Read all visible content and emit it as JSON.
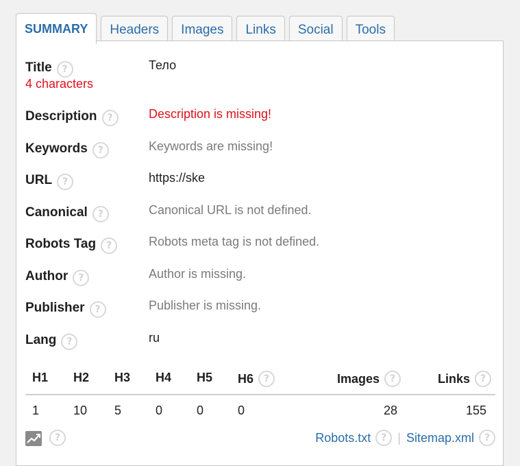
{
  "tabs": [
    {
      "label": "SUMMARY",
      "active": true
    },
    {
      "label": "Headers"
    },
    {
      "label": "Images"
    },
    {
      "label": "Links"
    },
    {
      "label": "Social"
    },
    {
      "label": "Tools"
    }
  ],
  "summary": {
    "title": {
      "label": "Title",
      "value": "Тело",
      "note": "4 characters"
    },
    "description": {
      "label": "Description",
      "value": "Description is missing!"
    },
    "keywords": {
      "label": "Keywords",
      "value": "Keywords are missing!"
    },
    "url": {
      "label": "URL",
      "value": "https://ske"
    },
    "canonical": {
      "label": "Canonical",
      "value": "Canonical URL is not defined."
    },
    "robots": {
      "label": "Robots Tag",
      "value": "Robots meta tag is not defined."
    },
    "author": {
      "label": "Author",
      "value": "Author is missing."
    },
    "publisher": {
      "label": "Publisher",
      "value": "Publisher is missing."
    },
    "lang": {
      "label": "Lang",
      "value": "ru"
    }
  },
  "stats": {
    "headers": [
      "H1",
      "H2",
      "H3",
      "H4",
      "H5",
      "H6",
      "Images",
      "Links"
    ],
    "values": [
      "1",
      "10",
      "5",
      "0",
      "0",
      "0",
      "28",
      "155"
    ]
  },
  "footer": {
    "robots_label": "Robots.txt",
    "sitemap_label": "Sitemap.xml",
    "separator": "|"
  },
  "icons": {
    "help": "help-circle-icon",
    "chart": "chart-icon"
  },
  "colors": {
    "accent": "#2b6ea8",
    "error": "#e0111b",
    "muted": "#7a7a7a"
  }
}
